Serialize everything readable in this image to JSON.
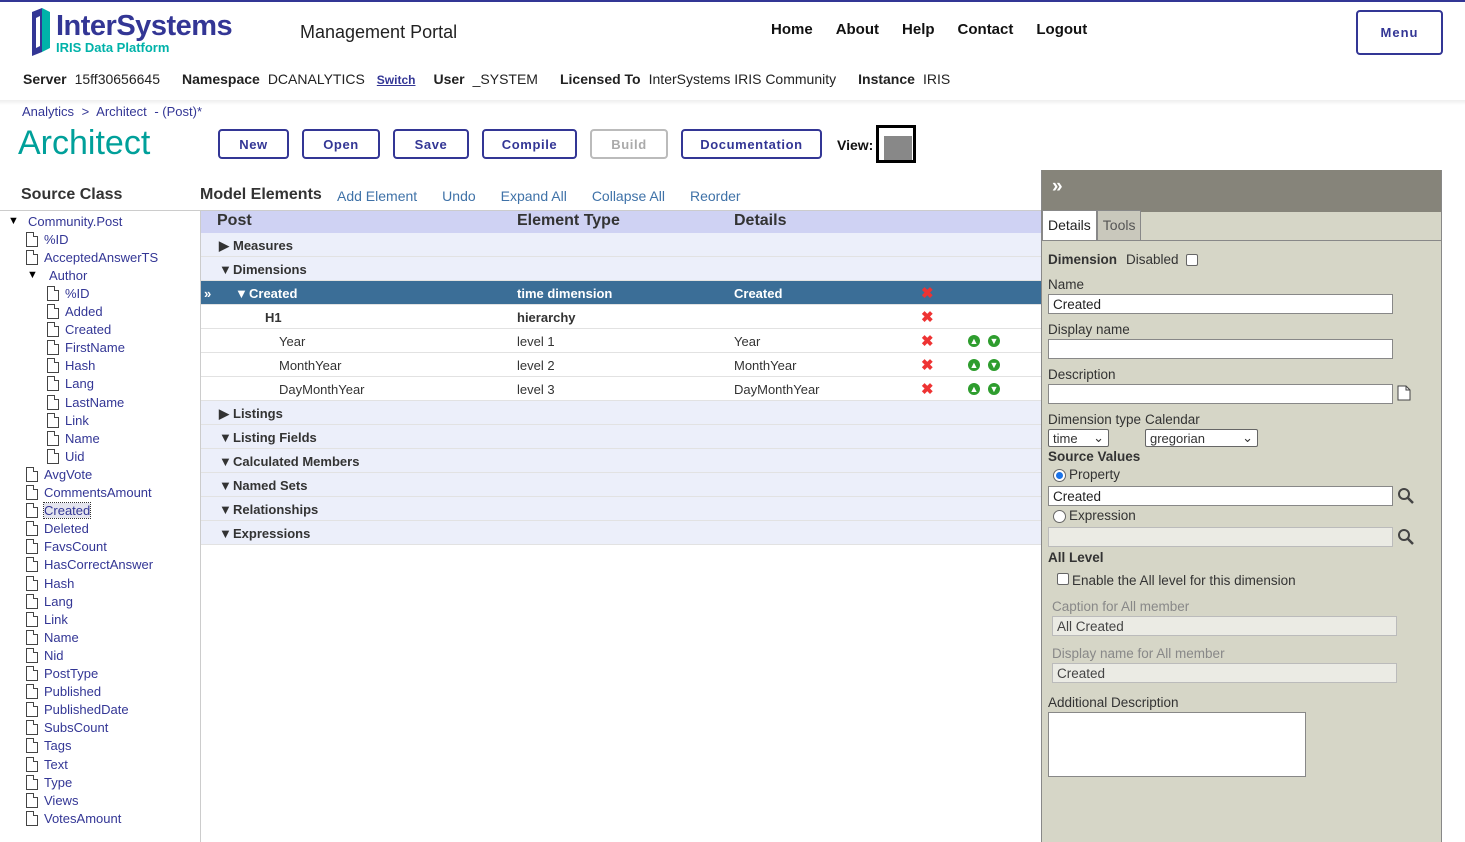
{
  "header": {
    "logo_title": "InterSystems",
    "logo_subtitle": "IRIS Data Platform",
    "portal_title": "Management Portal",
    "nav": [
      "Home",
      "About",
      "Help",
      "Contact",
      "Logout"
    ],
    "menu_label": "Menu"
  },
  "info": {
    "server_label": "Server",
    "server_value": "15ff30656645",
    "namespace_label": "Namespace",
    "namespace_value": "DCANALYTICS",
    "switch_label": "Switch",
    "user_label": "User",
    "user_value": "_SYSTEM",
    "licensed_label": "Licensed To",
    "licensed_value": "InterSystems IRIS Community",
    "instance_label": "Instance",
    "instance_value": "IRIS"
  },
  "breadcrumb": [
    "Analytics",
    ">",
    "Architect",
    " - (Post)*"
  ],
  "page_title": "Architect",
  "toolbar": {
    "buttons": [
      "New",
      "Open",
      "Save",
      "Compile",
      "Build",
      "Documentation"
    ],
    "view_label": "View:"
  },
  "source_class": {
    "heading": "Source Class",
    "items": [
      {
        "label": "Community.Post",
        "type": "folder-open",
        "indent": 0
      },
      {
        "label": "%ID",
        "type": "doc",
        "indent": 1
      },
      {
        "label": "AcceptedAnswerTS",
        "type": "doc",
        "indent": 1
      },
      {
        "label": "Author",
        "type": "folder-open",
        "indent": 1
      },
      {
        "label": "%ID",
        "type": "doc",
        "indent": 2
      },
      {
        "label": "Added",
        "type": "doc",
        "indent": 2
      },
      {
        "label": "Created",
        "type": "doc",
        "indent": 2
      },
      {
        "label": "FirstName",
        "type": "doc",
        "indent": 2
      },
      {
        "label": "Hash",
        "type": "doc",
        "indent": 2
      },
      {
        "label": "Lang",
        "type": "doc",
        "indent": 2
      },
      {
        "label": "LastName",
        "type": "doc",
        "indent": 2
      },
      {
        "label": "Link",
        "type": "doc",
        "indent": 2
      },
      {
        "label": "Name",
        "type": "doc",
        "indent": 2
      },
      {
        "label": "Uid",
        "type": "doc",
        "indent": 2
      },
      {
        "label": "AvgVote",
        "type": "doc",
        "indent": 1
      },
      {
        "label": "CommentsAmount",
        "type": "doc",
        "indent": 1
      },
      {
        "label": "Created",
        "type": "doc",
        "indent": 1,
        "selected": true
      },
      {
        "label": "Deleted",
        "type": "doc",
        "indent": 1
      },
      {
        "label": "FavsCount",
        "type": "doc",
        "indent": 1
      },
      {
        "label": "HasCorrectAnswer",
        "type": "doc",
        "indent": 1
      },
      {
        "label": "Hash",
        "type": "doc",
        "indent": 1
      },
      {
        "label": "Lang",
        "type": "doc",
        "indent": 1
      },
      {
        "label": "Link",
        "type": "doc",
        "indent": 1
      },
      {
        "label": "Name",
        "type": "doc",
        "indent": 1
      },
      {
        "label": "Nid",
        "type": "doc",
        "indent": 1
      },
      {
        "label": "PostType",
        "type": "doc",
        "indent": 1
      },
      {
        "label": "Published",
        "type": "doc",
        "indent": 1
      },
      {
        "label": "PublishedDate",
        "type": "doc",
        "indent": 1
      },
      {
        "label": "SubsCount",
        "type": "doc",
        "indent": 1
      },
      {
        "label": "Tags",
        "type": "doc",
        "indent": 1
      },
      {
        "label": "Text",
        "type": "doc",
        "indent": 1
      },
      {
        "label": "Type",
        "type": "doc",
        "indent": 1
      },
      {
        "label": "Views",
        "type": "doc",
        "indent": 1
      },
      {
        "label": "VotesAmount",
        "type": "doc",
        "indent": 1
      }
    ]
  },
  "model_elements": {
    "heading": "Model Elements",
    "links": [
      "Add Element",
      "Undo",
      "Expand All",
      "Collapse All",
      "Reorder"
    ],
    "columns": [
      "Post",
      "Element Type",
      "Details"
    ],
    "rows": [
      {
        "kind": "group",
        "toggle": "▶",
        "name": "Measures",
        "type": "",
        "details": ""
      },
      {
        "kind": "group",
        "toggle": "▼",
        "name": "Dimensions",
        "type": "",
        "details": ""
      },
      {
        "kind": "selected",
        "marker": "»",
        "toggle": "▼",
        "name": "Created",
        "type": "time dimension",
        "details": "Created",
        "delete": true
      },
      {
        "kind": "hier",
        "name": "H1",
        "type": "hierarchy",
        "details": "",
        "delete": true
      },
      {
        "kind": "level",
        "name": "Year",
        "type": "level 1",
        "details": "Year",
        "delete": true,
        "move": true
      },
      {
        "kind": "level",
        "name": "MonthYear",
        "type": "level 2",
        "details": "MonthYear",
        "delete": true,
        "move": true
      },
      {
        "kind": "level",
        "name": "DayMonthYear",
        "type": "level 3",
        "details": "DayMonthYear",
        "delete": true,
        "move": true
      },
      {
        "kind": "group",
        "toggle": "▶",
        "name": "Listings",
        "type": "",
        "details": ""
      },
      {
        "kind": "group",
        "toggle": "▼",
        "name": "Listing Fields",
        "type": "",
        "details": ""
      },
      {
        "kind": "group",
        "toggle": "▼",
        "name": "Calculated Members",
        "type": "",
        "details": ""
      },
      {
        "kind": "group",
        "toggle": "▼",
        "name": "Named Sets",
        "type": "",
        "details": ""
      },
      {
        "kind": "group",
        "toggle": "▼",
        "name": "Relationships",
        "type": "",
        "details": ""
      },
      {
        "kind": "group",
        "toggle": "▼",
        "name": "Expressions",
        "type": "",
        "details": ""
      }
    ]
  },
  "details_panel": {
    "expand_glyph": "»",
    "tabs": [
      "Details",
      "Tools"
    ],
    "dimension_label": "Dimension",
    "disabled_label": "Disabled",
    "name_label": "Name",
    "name_value": "Created",
    "display_name_label": "Display name",
    "display_name_value": "",
    "description_label": "Description",
    "description_value": "",
    "dimension_type_label": "Dimension type",
    "dimension_type_value": "time",
    "calendar_label": "Calendar",
    "calendar_value": "gregorian",
    "source_values_label": "Source Values",
    "property_label": "Property",
    "property_value": "Created",
    "expression_label": "Expression",
    "expression_value": "",
    "all_level_label": "All Level",
    "enable_all_label": "Enable the All level for this dimension",
    "caption_all_label": "Caption for All member",
    "caption_all_value": "All Created",
    "display_all_label": "Display name for All member",
    "display_all_value": "Created",
    "additional_desc_label": "Additional Description"
  },
  "colors": {
    "brand": "#333695",
    "accent": "#00a09a",
    "selected_row": "#3b6e97",
    "delete": "#ee3333",
    "move": "#2e9d2e"
  }
}
